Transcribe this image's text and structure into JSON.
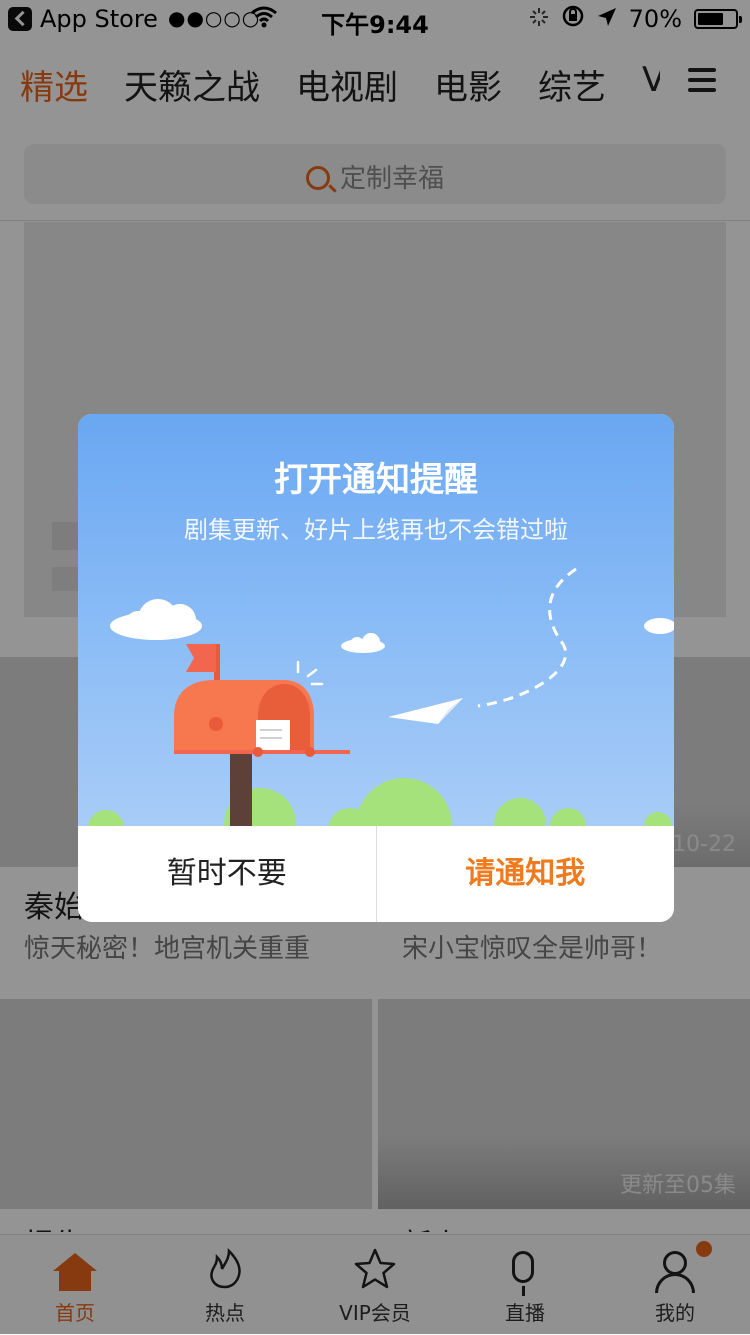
{
  "status_bar": {
    "back_app": "App Store",
    "signal": "●●○○○",
    "time": "下午9:44",
    "battery": "70%",
    "battery_level": 0.7
  },
  "top_tabs": [
    "精选",
    "天籁之战",
    "电视剧",
    "电影",
    "综艺",
    "V"
  ],
  "search": {
    "placeholder": "定制幸福"
  },
  "feed": {
    "items": [
      {
        "title": "秦始",
        "subtitle": "惊天秘密！地宫机关重重",
        "badge": ""
      },
      {
        "title": "",
        "subtitle": "宋小宝惊叹全是帅哥！",
        "badge": "10-22"
      },
      {
        "title": "报告",
        "subtitle": "",
        "badge": ""
      },
      {
        "title": "新上",
        "subtitle": "",
        "badge": "更新至05集"
      }
    ]
  },
  "tabbar": {
    "items": [
      {
        "label": "首页",
        "icon": "home-icon"
      },
      {
        "label": "热点",
        "icon": "flame-icon"
      },
      {
        "label": "VIP会员",
        "icon": "star-icon"
      },
      {
        "label": "直播",
        "icon": "microphone-icon"
      },
      {
        "label": "我的",
        "icon": "profile-icon"
      }
    ]
  },
  "dialog": {
    "title": "打开通知提醒",
    "subtitle": "剧集更新、好片上线再也不会错过啦",
    "cancel_label": "暂时不要",
    "confirm_label": "请通知我"
  },
  "colors": {
    "accent": "#e8651b",
    "dialog_sky": "#6aa7f2",
    "confirm": "#f07a1e"
  }
}
